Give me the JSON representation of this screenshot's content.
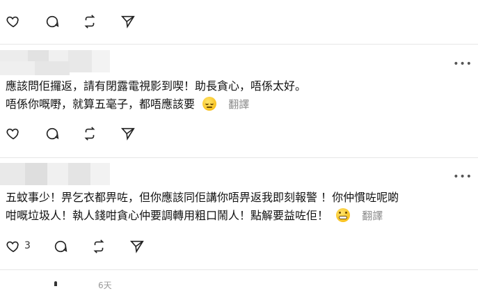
{
  "icons": {
    "like": "heart-icon",
    "comment": "comment-bubble-icon",
    "repost": "repost-icon",
    "share": "send-icon",
    "more": "more-dots-icon"
  },
  "more_label": "•••",
  "post1": {
    "author": "",
    "lines": [
      "應該問佢攞返，請有閉露電視影到喫！助長貪心，唔係太好。",
      "唔係你嘅嘢，就算五毫子，都唔應該要"
    ],
    "emoji": "relieved-face-emoji",
    "translate_label": "翻譯"
  },
  "post2": {
    "author": "",
    "lines": [
      "五蚊事少！畀乞衣都畀咗，但你應該同佢講你唔畀返我即刻報警 ！你仲慣咗呢啲",
      "咁嘅垃圾人！執人錢咁貪心仲要調轉用粗口鬧人！點解要益咗佢！"
    ],
    "emoji": "grimacing-face-emoji",
    "translate_label": "翻譯",
    "like_count": "3"
  },
  "partial_next": "6天"
}
